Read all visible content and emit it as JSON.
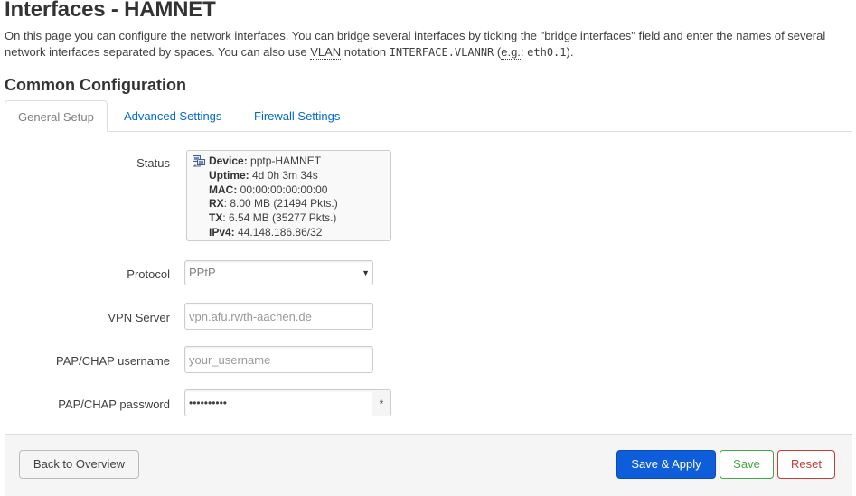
{
  "page": {
    "title": "Interfaces - HAMNET",
    "desc_part1": "On this page you can configure the network interfaces. You can bridge several interfaces by ticking the \"bridge interfaces\" field and enter the names of several network interfaces separated by spaces. You can also use ",
    "desc_vlan": "VLAN",
    "desc_part2": " notation ",
    "desc_code1": "INTERFACE.VLANNR",
    "desc_part3": " (",
    "desc_eg": "e.g.",
    "desc_part4": ": ",
    "desc_code2": "eth0.1",
    "desc_part5": ")."
  },
  "section": {
    "title": "Common Configuration"
  },
  "tabs": [
    {
      "label": "General Setup",
      "active": true
    },
    {
      "label": "Advanced Settings",
      "active": false
    },
    {
      "label": "Firewall Settings",
      "active": false
    }
  ],
  "status": {
    "label": "Status",
    "icon": "network-device-icon",
    "device_key": "Device:",
    "device_val": " pptp-HAMNET",
    "uptime_key": "Uptime:",
    "uptime_val": " 4d 0h 3m 34s",
    "mac_key": "MAC:",
    "mac_val": " 00:00:00:00:00:00",
    "rx_key": "RX",
    "rx_val": ": 8.00 MB (21494 Pkts.)",
    "tx_key": "TX",
    "tx_val": ": 6.54 MB (35277 Pkts.)",
    "ipv4_key": "IPv4:",
    "ipv4_val": " 44.148.186.86/32"
  },
  "form": {
    "protocol_label": "Protocol",
    "protocol_value": "PPtP",
    "vpn_server_label": "VPN Server",
    "vpn_server_placeholder": "vpn.afu.rwth-aachen.de",
    "username_label": "PAP/CHAP username",
    "username_placeholder": "your_username",
    "password_label": "PAP/CHAP password",
    "password_mask": "••••••••••",
    "reveal_glyph": "*"
  },
  "footer": {
    "back_label": "Back to Overview",
    "apply_label": "Save & Apply",
    "save_label": "Save",
    "reset_label": "Reset"
  },
  "colors": {
    "link": "#0069d6",
    "primary_button": "#0e5edb",
    "save_green": "#46a546",
    "reset_red": "#c43c35"
  }
}
